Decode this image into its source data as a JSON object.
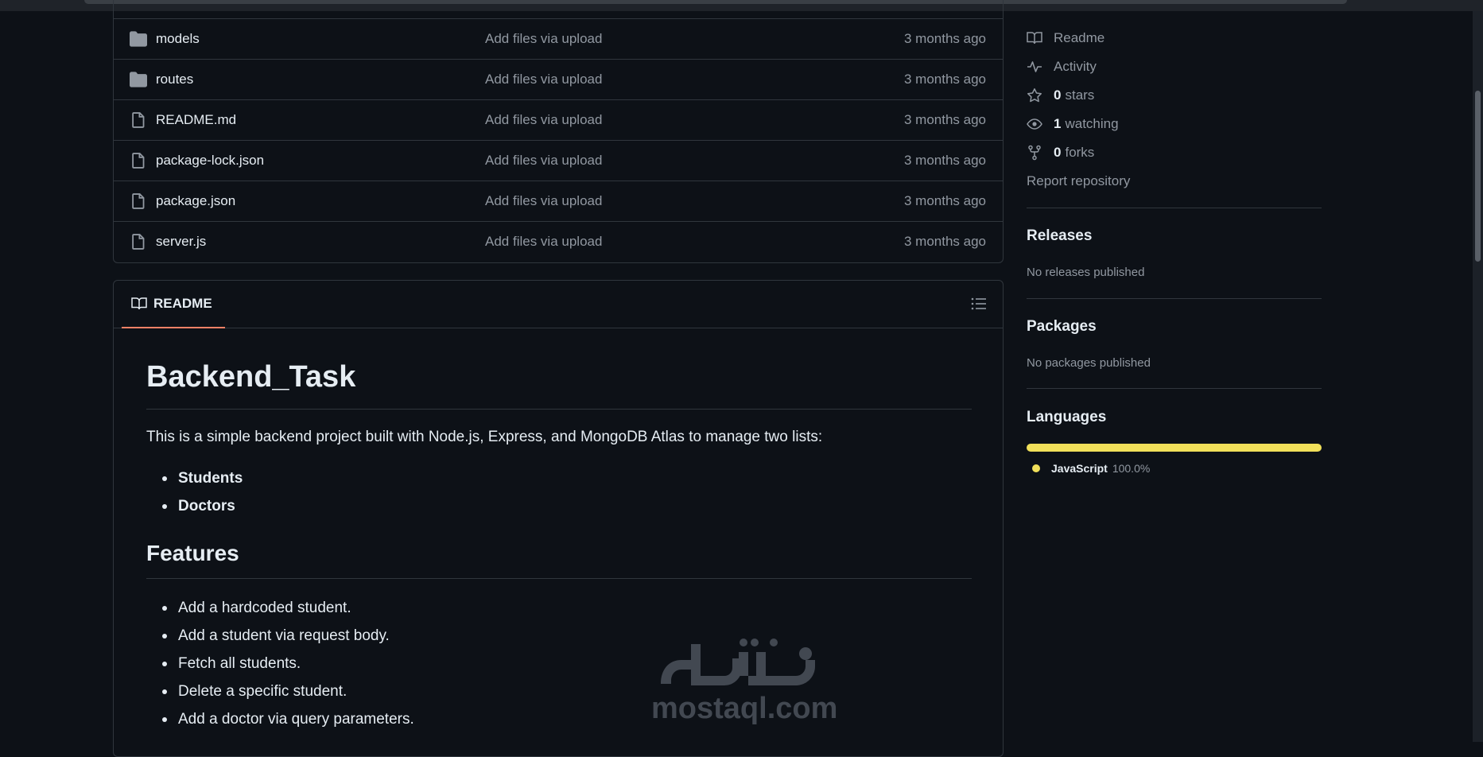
{
  "files": [
    {
      "name": "models",
      "type": "folder",
      "message": "Add files via upload",
      "date": "3 months ago"
    },
    {
      "name": "routes",
      "type": "folder",
      "message": "Add files via upload",
      "date": "3 months ago"
    },
    {
      "name": "README.md",
      "type": "file",
      "message": "Add files via upload",
      "date": "3 months ago"
    },
    {
      "name": "package-lock.json",
      "type": "file",
      "message": "Add files via upload",
      "date": "3 months ago"
    },
    {
      "name": "package.json",
      "type": "file",
      "message": "Add files via upload",
      "date": "3 months ago"
    },
    {
      "name": "server.js",
      "type": "file",
      "message": "Add files via upload",
      "date": "3 months ago"
    }
  ],
  "readme": {
    "tab_label": "README",
    "title": "Backend_Task",
    "intro": "This is a simple backend project built with Node.js, Express, and MongoDB Atlas to manage two lists:",
    "lists": [
      "Students",
      "Doctors"
    ],
    "features_heading": "Features",
    "features": [
      "Add a hardcoded student.",
      "Add a student via request body.",
      "Fetch all students.",
      "Delete a specific student.",
      "Add a doctor via query parameters."
    ]
  },
  "sidebar": {
    "readme_label": "Readme",
    "activity_label": "Activity",
    "stars_count": "0",
    "stars_label": "stars",
    "watching_count": "1",
    "watching_label": "watching",
    "forks_count": "0",
    "forks_label": "forks",
    "report_label": "Report repository",
    "releases_title": "Releases",
    "releases_text": "No releases published",
    "packages_title": "Packages",
    "packages_text": "No packages published",
    "languages_title": "Languages",
    "languages": [
      {
        "name": "JavaScript",
        "percent": "100.0%",
        "color": "#f1e05a"
      }
    ]
  },
  "watermark": {
    "text": "mostaql.com"
  },
  "colors": {
    "accent": "#f78166",
    "background": "#0d1117",
    "border": "#30363d",
    "muted": "#9198a1"
  }
}
